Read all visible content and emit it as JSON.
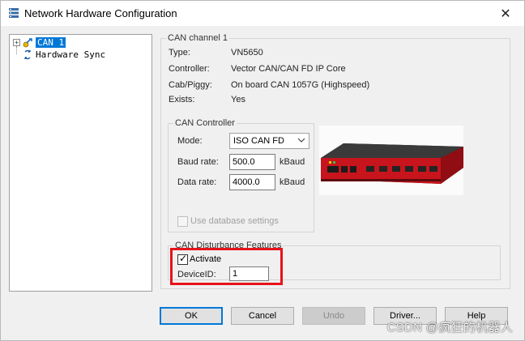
{
  "window": {
    "title": "Network Hardware Configuration",
    "close_glyph": "✕"
  },
  "tree": {
    "items": [
      {
        "label": "CAN 1",
        "expander": "+",
        "selected": true,
        "icon": "network-device-icon"
      },
      {
        "label": "Hardware Sync",
        "icon": "sync-icon"
      }
    ]
  },
  "channel": {
    "group_title": "CAN channel 1",
    "rows": [
      {
        "label": "Type:",
        "value": "VN5650"
      },
      {
        "label": "Controller:",
        "value": "Vector CAN/CAN FD IP Core"
      },
      {
        "label": "Cab/Piggy:",
        "value": "On board CAN 1057G (Highspeed)"
      },
      {
        "label": "Exists:",
        "value": "Yes"
      }
    ]
  },
  "can_controller": {
    "group_title": "CAN Controller",
    "mode_label": "Mode:",
    "mode_value": "ISO CAN FD",
    "baud_label": "Baud rate:",
    "baud_value": "500.0",
    "baud_unit": "kBaud",
    "data_label": "Data rate:",
    "data_value": "4000.0",
    "data_unit": "kBaud",
    "use_db_label": "Use database settings",
    "use_db_checked": false,
    "use_db_enabled": false
  },
  "disturbance": {
    "group_title": "CAN Disturbance Features",
    "activate_label": "Activate",
    "activate_checked": true,
    "device_id_label": "DeviceID:",
    "device_id_value": "1"
  },
  "buttons": {
    "ok": "OK",
    "cancel": "Cancel",
    "undo": "Undo",
    "driver": "Driver...",
    "help": "Help"
  },
  "watermark": "CSDN @疯狂的机器人",
  "colors": {
    "selection": "#0078d7",
    "highlight": "#e8121a",
    "device_red": "#c8141c"
  }
}
